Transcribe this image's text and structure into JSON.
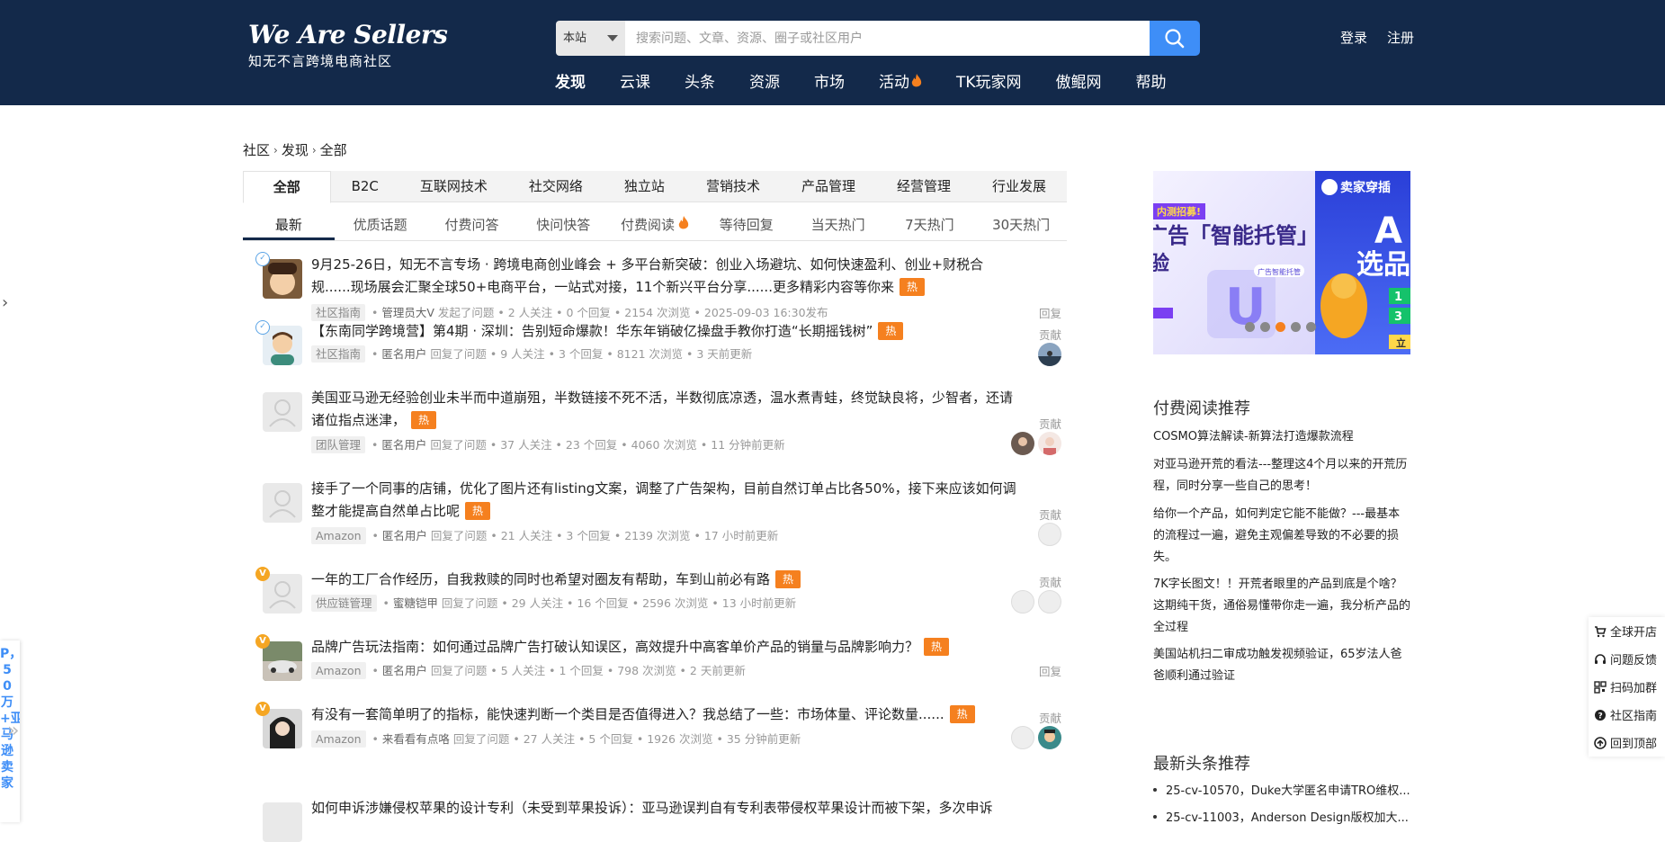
{
  "brand": {
    "title": "We Are Sellers",
    "subtitle": "知无不言跨境电商社区"
  },
  "search": {
    "scope": "本站",
    "placeholder": "搜索问题、文章、资源、圈子或社区用户"
  },
  "header_links": {
    "login": "登录",
    "register": "注册"
  },
  "nav": [
    "发现",
    "云课",
    "头条",
    "资源",
    "市场",
    "活动",
    "TK玩家网",
    "傲鲲网",
    "帮助"
  ],
  "breadcrumb": [
    "社区",
    "发现",
    "全部"
  ],
  "category_tabs": [
    "全部",
    "B2C",
    "互联网技术",
    "社交网络",
    "独立站",
    "营销技术",
    "产品管理",
    "经营管理",
    "行业发展"
  ],
  "sort_tabs": [
    "最新",
    "优质话题",
    "付费问答",
    "快问快答",
    "付费阅读",
    "等待回复",
    "当天热门",
    "7天热门",
    "30天热门"
  ],
  "hot_label": "热",
  "contrib_label": "贡献",
  "reply_label": "回复",
  "feed": [
    {
      "title": "9月25-26日，知无不言专场 · 跨境电商创业峰会 + 多平台新突破：创业入场避坑、如何快速盈利、创业+财税合规......现场展会汇聚全球50+电商平台，一站式对接，11个新兴平台分享......更多精彩内容等你来",
      "tag": "社区指南",
      "user": "管理员大V",
      "action": "发起了问题",
      "follows": "2 人关注",
      "replies": "0 个回复",
      "views": "2154 次浏览",
      "time": "2025-09-03 16:30发布"
    },
    {
      "title": "【东南同学跨境营】第4期 · 深圳：告别短命爆款！华东年销破亿操盘手教你打造“长期摇钱树”",
      "tag": "社区指南",
      "user": "匿名用户",
      "action": "回复了问题",
      "follows": "9 人关注",
      "replies": "3 个回复",
      "views": "8121 次浏览",
      "time": "3 天前更新"
    },
    {
      "title": "美国亚马逊无经验创业未半而中道崩殂，半数链接不死不活，半数彻底凉透，温水煮青蛙，终觉缺良将，少智者，还请诸位指点迷津，",
      "tag": "团队管理",
      "user": "匿名用户",
      "action": "回复了问题",
      "follows": "37 人关注",
      "replies": "23 个回复",
      "views": "4060 次浏览",
      "time": "11 分钟前更新"
    },
    {
      "title": "接手了一个同事的店铺，优化了图片还有listing文案，调整了广告架构，目前自然订单占比各50%，接下来应该如何调整才能提高自然单占比呢",
      "tag": "Amazon",
      "user": "匿名用户",
      "action": "回复了问题",
      "follows": "21 人关注",
      "replies": "3 个回复",
      "views": "2139 次浏览",
      "time": "17 小时前更新"
    },
    {
      "title": "一年的工厂合作经历，自我救赎的同时也希望对圈友有帮助，车到山前必有路",
      "tag": "供应链管理",
      "user": "蜜糖铠甲",
      "action": "回复了问题",
      "follows": "29 人关注",
      "replies": "16 个回复",
      "views": "2596 次浏览",
      "time": "13 小时前更新"
    },
    {
      "title": "品牌广告玩法指南：如何通过品牌广告打破认知误区，高效提升中高客单价产品的销量与品牌影响力？",
      "tag": "Amazon",
      "user": "匿名用户",
      "action": "回复了问题",
      "follows": "5 人关注",
      "replies": "1 个回复",
      "views": "798 次浏览",
      "time": "2 天前更新"
    },
    {
      "title": "有没有一套简单明了的指标，能快速判断一个类目是否值得进入？我总结了一些：市场体量、评论数量......",
      "tag": "Amazon",
      "user": "来看看有点咯",
      "action": "回复了问题",
      "follows": "27 人关注",
      "replies": "5 个回复",
      "views": "1926 次浏览",
      "time": "35 分钟前更新"
    },
    {
      "title": "如何申诉涉嫌侵权苹果的设计专利（未受到苹果投诉）：亚马逊误判自有专利表带侵权苹果设计而被下架，多次申诉"
    }
  ],
  "banner": {
    "badge": "内测招募!",
    "headline": "广告「智能托管」",
    "sub": "验",
    "chip": "广告智能托管",
    "brand2": "卖家穿插",
    "big": "A",
    "big2": "选品",
    "n1": "1",
    "n2": "3",
    "btn": "立"
  },
  "paid_reading": {
    "title": "付费阅读推荐",
    "items": [
      "COSMO算法解读-新算法打造爆款流程",
      "对亚马逊开荒的看法---整理这4个月以来的开荒历程，同时分享一些自己的思考！",
      "给你一个产品，如何判定它能不能做？---最基本的流程过一遍，避免主观偏差导致的不必要的损失。",
      "7K字长图文！！开荒者眼里的产品到底是个啥？这期纯干货，通俗易懂带你走一遍，我分析产品的全过程",
      "美国站机扫二审成功触发视频验证，65岁法人爸爸顺利通过验证"
    ]
  },
  "news": {
    "title": "最新头条推荐",
    "items": [
      "25-cv-10570，Duke大学匿名申请TRO维权...",
      "25-cv-11003，Anderson Design版权加大..."
    ]
  },
  "left_float_text": "P，50万+亚马逊卖家",
  "right_float": [
    "全球开店",
    "问题反馈",
    "扫码加群",
    "社区指南",
    "回到顶部"
  ],
  "colors": {
    "header_bg": "#13294a",
    "accent": "#3e8ef7",
    "hot": "#f5801f"
  }
}
